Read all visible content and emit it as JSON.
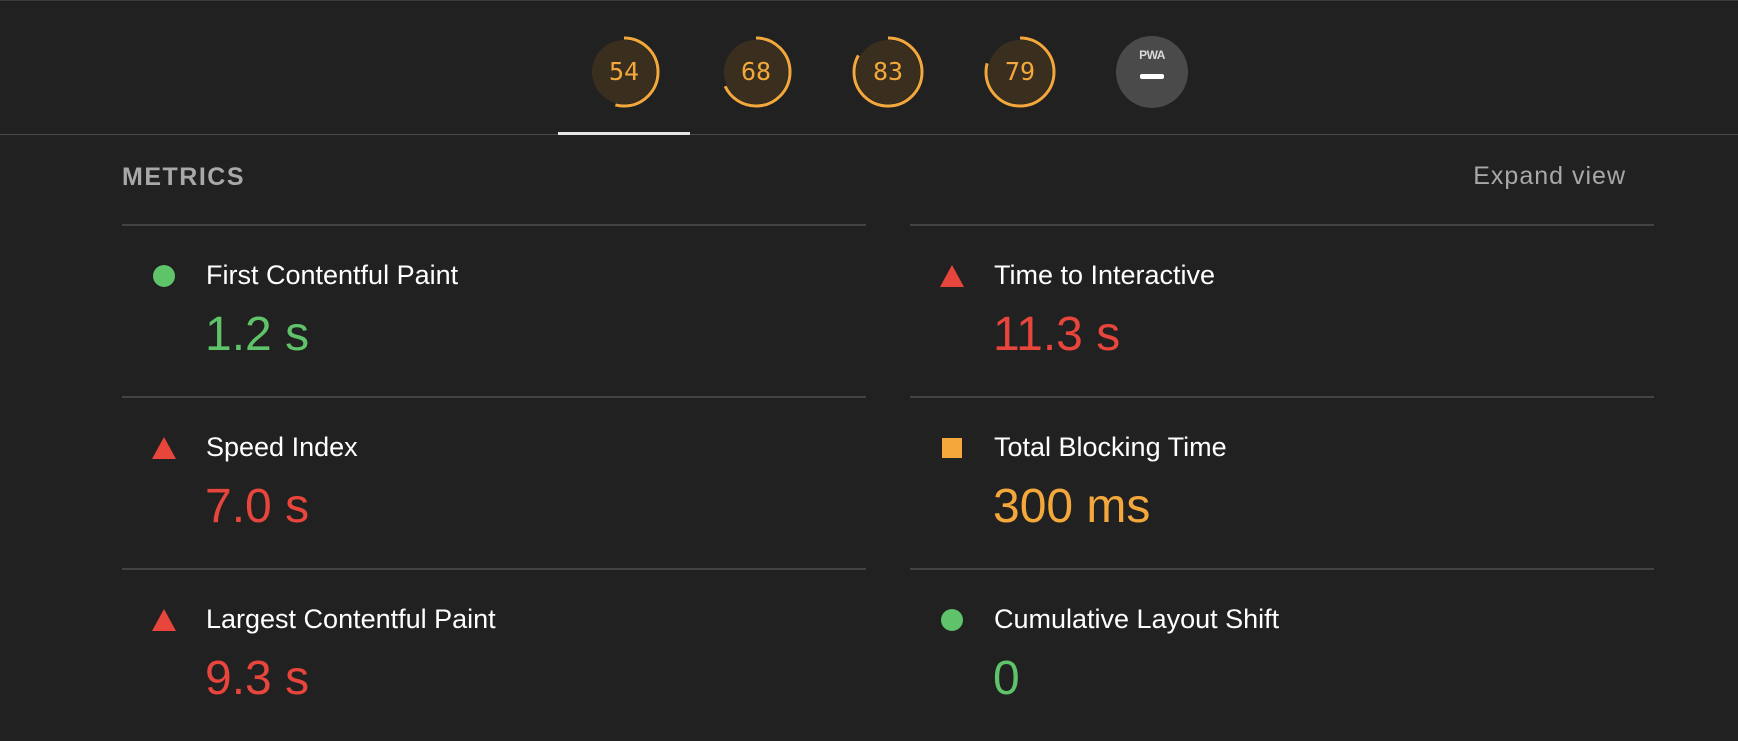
{
  "gauges": [
    {
      "score": "54",
      "fraction": 0.54,
      "color": "#f4a83c",
      "active": true
    },
    {
      "score": "68",
      "fraction": 0.68,
      "color": "#f4a83c",
      "active": false
    },
    {
      "score": "83",
      "fraction": 0.83,
      "color": "#f4a83c",
      "active": false
    },
    {
      "score": "79",
      "fraction": 0.79,
      "color": "#f4a83c",
      "active": false
    }
  ],
  "pwa": {
    "label": "PWA",
    "icon": "pwa-dash-icon"
  },
  "metrics_header": {
    "title": "METRICS",
    "expand_label": "Expand view"
  },
  "metrics": [
    {
      "label": "First Contentful Paint",
      "value": "1.2 s",
      "status": "pass",
      "icon": "green-circle-icon"
    },
    {
      "label": "Time to Interactive",
      "value": "11.3 s",
      "status": "fail",
      "icon": "red-triangle-icon"
    },
    {
      "label": "Speed Index",
      "value": "7.0 s",
      "status": "fail",
      "icon": "red-triangle-icon"
    },
    {
      "label": "Total Blocking Time",
      "value": "300 ms",
      "status": "average",
      "icon": "orange-square-icon"
    },
    {
      "label": "Largest Contentful Paint",
      "value": "9.3 s",
      "status": "fail",
      "icon": "red-triangle-icon"
    },
    {
      "label": "Cumulative Layout Shift",
      "value": "0",
      "status": "pass",
      "icon": "green-circle-icon"
    }
  ],
  "colors": {
    "background": "#212121",
    "pass": "#5fc36a",
    "average": "#f4a83c",
    "fail": "#e8453c",
    "muted_text": "#a8a8a8"
  }
}
